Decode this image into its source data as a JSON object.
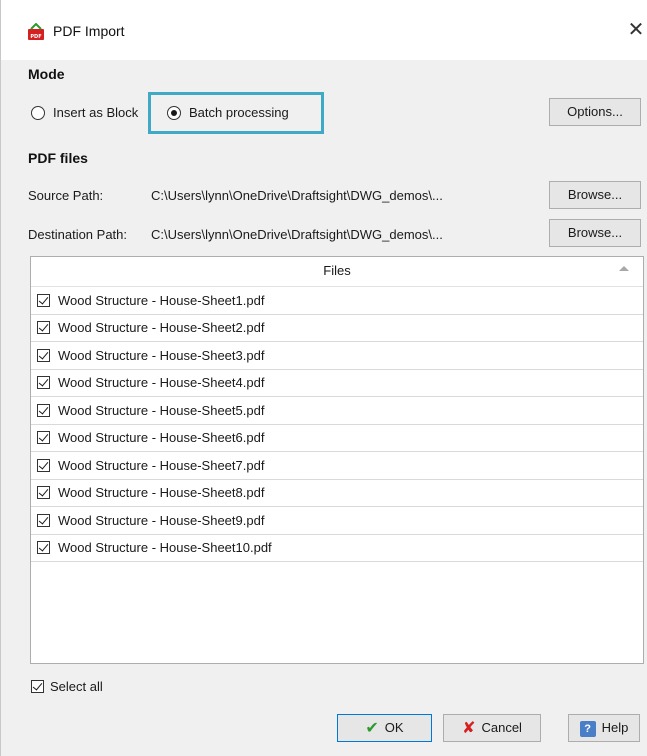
{
  "window": {
    "title": "PDF Import",
    "close_glyph": "✕"
  },
  "mode": {
    "section_label": "Mode",
    "radio_insert_label": "Insert as Block",
    "radio_batch_label": "Batch processing",
    "selected": "batch",
    "options_label": "Options...",
    "highlight_color": "#3fa9c6"
  },
  "pdf_files": {
    "section_label": "PDF files",
    "source_label": "Source Path:",
    "source_value": "C:\\Users\\lynn\\OneDrive\\Draftsight\\DWG_demos\\...",
    "destination_label": "Destination Path:",
    "destination_value": "C:\\Users\\lynn\\OneDrive\\Draftsight\\DWG_demos\\...",
    "browse_label": "Browse..."
  },
  "files": {
    "header": "Files",
    "items": [
      {
        "name": "Wood Structure - House-Sheet1.pdf",
        "checked": true
      },
      {
        "name": "Wood Structure - House-Sheet2.pdf",
        "checked": true
      },
      {
        "name": "Wood Structure - House-Sheet3.pdf",
        "checked": true
      },
      {
        "name": "Wood Structure - House-Sheet4.pdf",
        "checked": true
      },
      {
        "name": "Wood Structure - House-Sheet5.pdf",
        "checked": true
      },
      {
        "name": "Wood Structure - House-Sheet6.pdf",
        "checked": true
      },
      {
        "name": "Wood Structure - House-Sheet7.pdf",
        "checked": true
      },
      {
        "name": "Wood Structure - House-Sheet8.pdf",
        "checked": true
      },
      {
        "name": "Wood Structure - House-Sheet9.pdf",
        "checked": true
      },
      {
        "name": "Wood Structure - House-Sheet10.pdf",
        "checked": true
      }
    ]
  },
  "select_all": {
    "label": "Select all",
    "checked": true
  },
  "footer": {
    "ok_label": "OK",
    "cancel_label": "Cancel",
    "help_label": "Help"
  },
  "icons": {
    "app": "pdf-icon",
    "ok": "checkmark-icon",
    "cancel": "x-icon",
    "help": "question-icon"
  }
}
